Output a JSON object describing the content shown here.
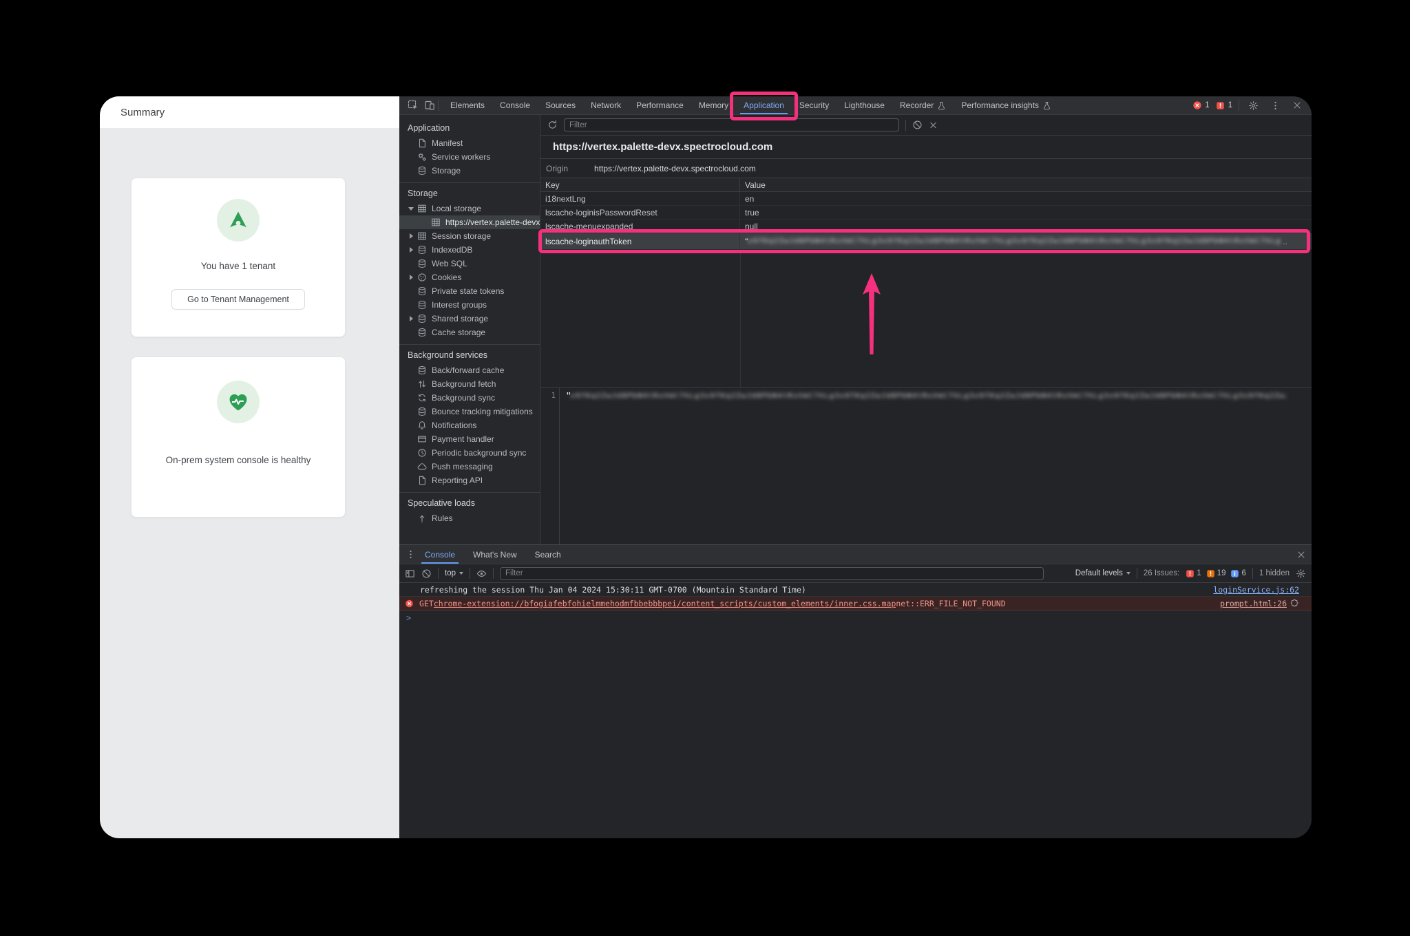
{
  "colors": {
    "accent_blue": "#7cacf8",
    "highlight_pink": "#f5317f",
    "error_red": "#f0524b",
    "warning_orange": "#e8710a",
    "info_blue": "#669df6",
    "success_green": "#2f9e55"
  },
  "summary_page": {
    "title": "Summary",
    "cards": [
      {
        "icon": "tenant-logo-icon",
        "message": "You have 1 tenant",
        "button_label": "Go to Tenant Management"
      },
      {
        "icon": "health-heart-icon",
        "message": "On-prem system console is healthy"
      }
    ]
  },
  "devtools": {
    "main_tabs": [
      {
        "label": "Elements"
      },
      {
        "label": "Console"
      },
      {
        "label": "Sources"
      },
      {
        "label": "Network"
      },
      {
        "label": "Performance"
      },
      {
        "label": "Memory"
      },
      {
        "label": "Application",
        "active": true,
        "highlighted": true
      },
      {
        "label": "Security"
      },
      {
        "label": "Lighthouse"
      },
      {
        "label": "Recorder",
        "flask": true
      },
      {
        "label": "Performance insights",
        "flask": true
      }
    ],
    "top_badges": {
      "error_count": "1",
      "issue_count": "1"
    },
    "sidebar": {
      "sections": [
        {
          "title": "Application",
          "items": [
            {
              "label": "Manifest",
              "icon": "file-icon"
            },
            {
              "label": "Service workers",
              "icon": "service-worker-icon"
            },
            {
              "label": "Storage",
              "icon": "database-icon"
            }
          ]
        },
        {
          "title": "Storage",
          "items": [
            {
              "label": "Local storage",
              "icon": "table-icon",
              "arrow": "expanded"
            },
            {
              "label": "https://vertex.palette-devx",
              "icon": "table-icon",
              "selected": true,
              "depth": 2
            },
            {
              "label": "Session storage",
              "icon": "table-icon",
              "arrow": "collapsed"
            },
            {
              "label": "IndexedDB",
              "icon": "database-icon",
              "arrow": "collapsed"
            },
            {
              "label": "Web SQL",
              "icon": "database-icon"
            },
            {
              "label": "Cookies",
              "icon": "cookie-icon",
              "arrow": "collapsed"
            },
            {
              "label": "Private state tokens",
              "icon": "database-icon"
            },
            {
              "label": "Interest groups",
              "icon": "database-icon"
            },
            {
              "label": "Shared storage",
              "icon": "database-icon",
              "arrow": "collapsed"
            },
            {
              "label": "Cache storage",
              "icon": "database-icon"
            }
          ]
        },
        {
          "title": "Background services",
          "items": [
            {
              "label": "Back/forward cache",
              "icon": "database-icon"
            },
            {
              "label": "Background fetch",
              "icon": "fetch-icon"
            },
            {
              "label": "Background sync",
              "icon": "sync-icon"
            },
            {
              "label": "Bounce tracking mitigations",
              "icon": "database-icon"
            },
            {
              "label": "Notifications",
              "icon": "bell-icon"
            },
            {
              "label": "Payment handler",
              "icon": "payment-icon"
            },
            {
              "label": "Periodic background sync",
              "icon": "clock-icon"
            },
            {
              "label": "Push messaging",
              "icon": "cloud-icon"
            },
            {
              "label": "Reporting API",
              "icon": "file-icon"
            }
          ]
        },
        {
          "title": "Speculative loads",
          "items": [
            {
              "label": "Rules",
              "icon": "rules-icon"
            }
          ]
        }
      ]
    },
    "storage_panel": {
      "filter_placeholder": "Filter",
      "site_url": "https://vertex.palette-devx.spectrocloud.com",
      "origin_label": "Origin",
      "origin_url": "https://vertex.palette-devx.spectrocloud.com",
      "columns": [
        "Key",
        "Value"
      ],
      "rows": [
        {
          "key": "i18nextLng",
          "value": "en"
        },
        {
          "key": "lscache-loginisPasswordReset",
          "value": "true"
        },
        {
          "key": "lscache-menuexpanded",
          "value": "null"
        },
        {
          "key": "lscache-loginauthToken",
          "value_redacted": true,
          "selected": true,
          "highlighted": true
        }
      ],
      "redaction": {
        "leading_quote": "\"",
        "ellipsis": ".."
      },
      "preview_line_number": "1",
      "preview_redacted": true
    },
    "console_drawer": {
      "tabs": [
        {
          "label": "Console",
          "active": true
        },
        {
          "label": "What's New"
        },
        {
          "label": "Search"
        }
      ],
      "context_selector": "top",
      "filter_placeholder": "Filter",
      "levels_selector": "Default levels",
      "issues_label": "26 Issues:",
      "issue_badges": [
        {
          "count": "1",
          "type": "error"
        },
        {
          "count": "19",
          "type": "warning"
        },
        {
          "count": "6",
          "type": "info"
        }
      ],
      "hidden_label": "1 hidden",
      "prompt_char": ">",
      "messages": [
        {
          "level": "log",
          "text": "refreshing the session Thu Jan 04 2024 15:30:11 GMT-0700 (Mountain Standard Time)",
          "source": "loginService.js:62"
        },
        {
          "level": "error",
          "prefix": "GET ",
          "link_text": "chrome-extension://bfogiafebfohielmmehodmfbbebbbpei/content_scripts/custom_elements/inner.css.map",
          "suffix": " net::ERR_FILE_NOT_FOUND",
          "source": "prompt.html:26",
          "extension_icon": true
        }
      ]
    }
  }
}
